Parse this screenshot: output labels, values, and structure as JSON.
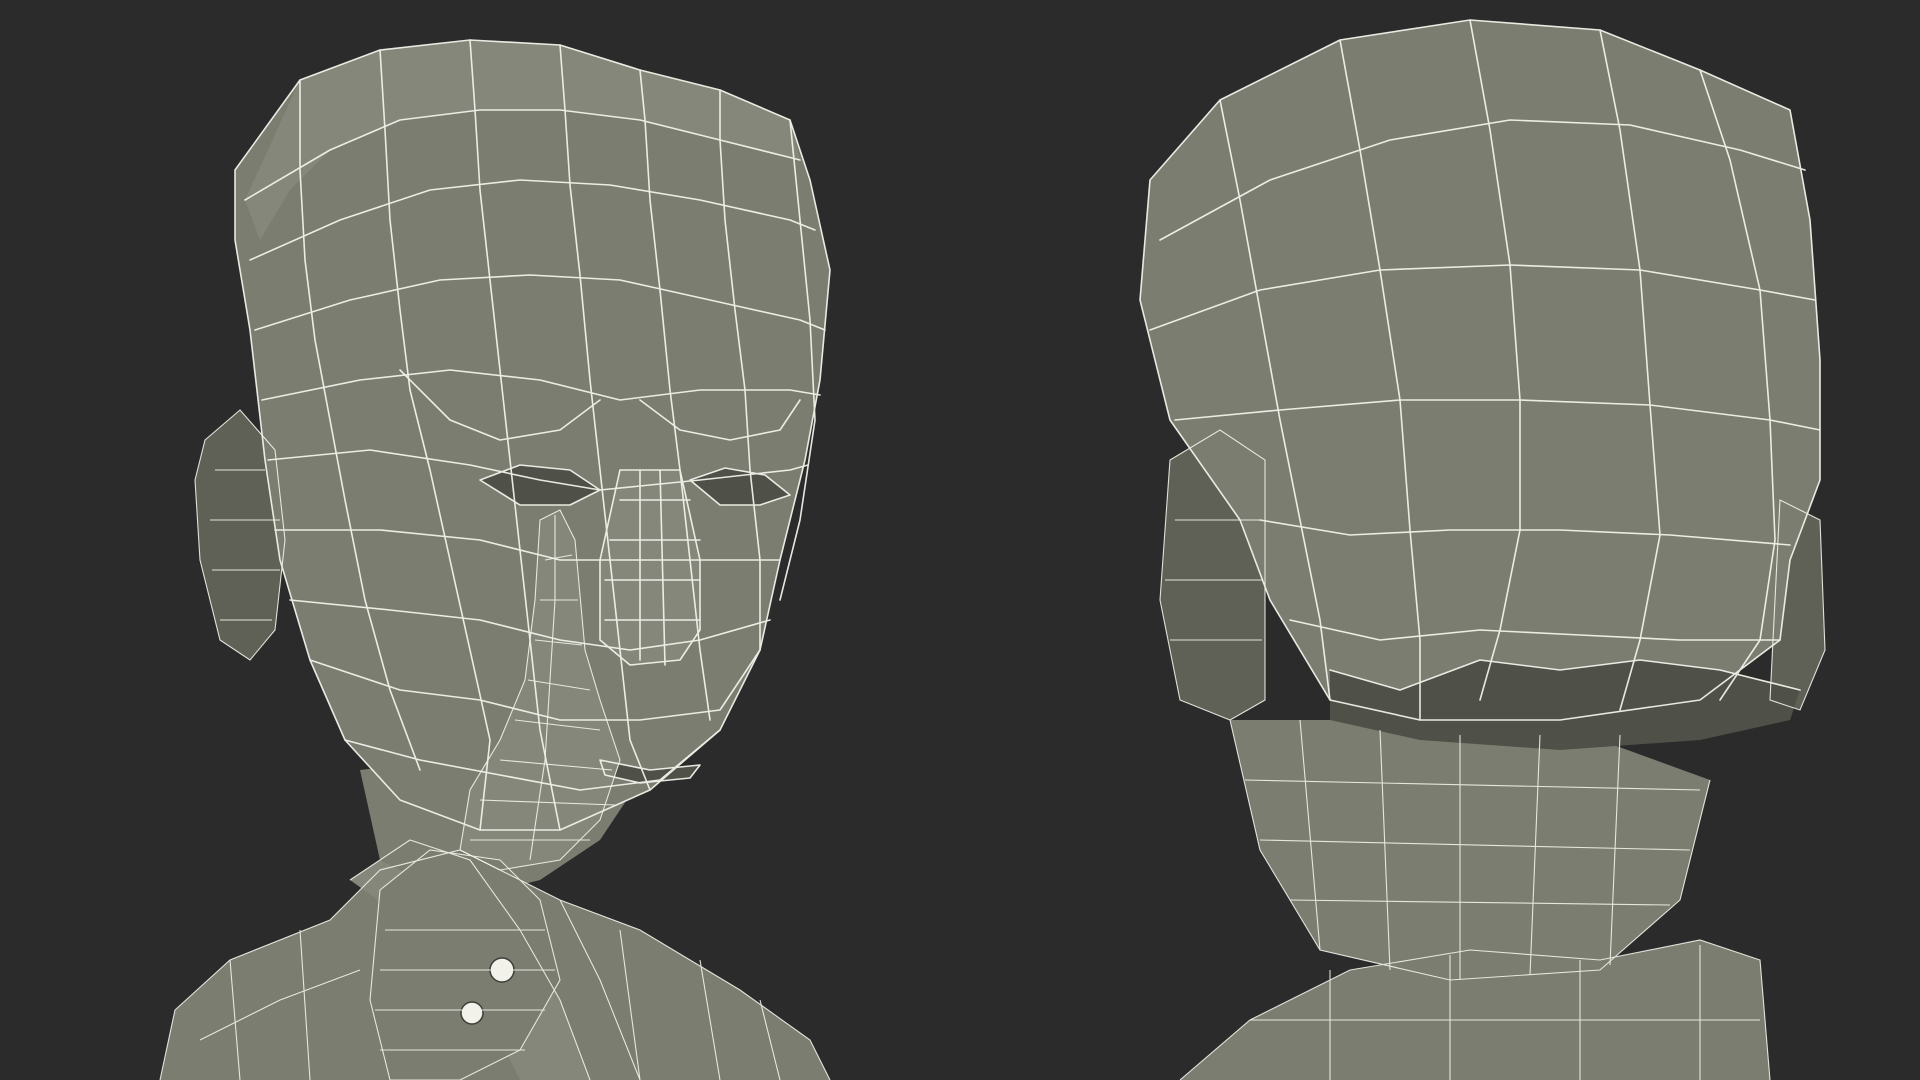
{
  "colors": {
    "background": "#2b2b2b",
    "mesh_fill": "#7b7d70",
    "wireframe": "#f2f2ea"
  },
  "models": [
    {
      "view": "front",
      "subject": "head-with-hand"
    },
    {
      "view": "back",
      "subject": "head-back"
    }
  ]
}
